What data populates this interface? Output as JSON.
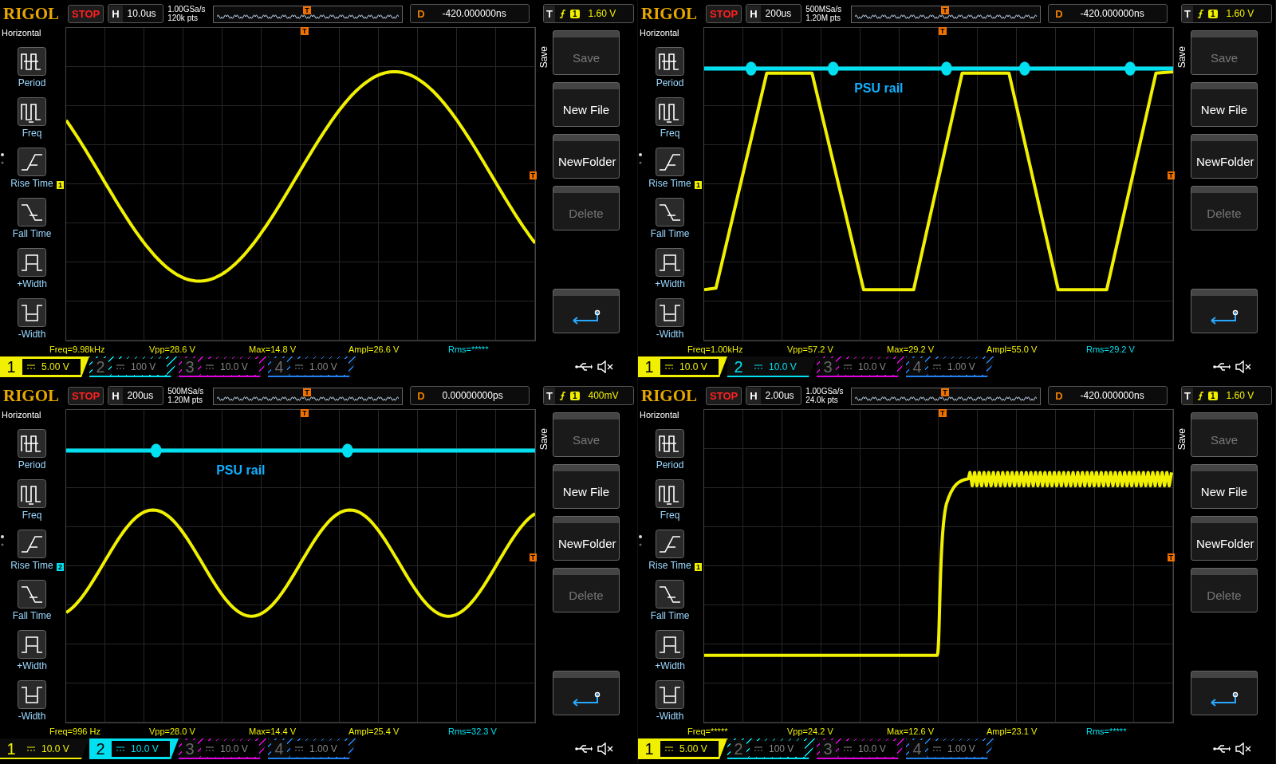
{
  "panels": [
    {
      "brand": "RIGOL",
      "status": "STOP",
      "timebase": {
        "label": "H",
        "value": "10.0us"
      },
      "sample_rate": "1.00GSa/s",
      "memory_depth": "120k pts",
      "memory_marker": "T",
      "delay": {
        "label": "D",
        "value": "-420.000000ns"
      },
      "trigger": {
        "label": "T",
        "source": "1",
        "level": "1.60 V"
      },
      "sidebar": {
        "title": "Horizontal",
        "items": [
          "Period",
          "Freq",
          "Rise Time",
          "Fall Time",
          "+Width",
          "-Width"
        ]
      },
      "graticule": {
        "trigger_marker": "T",
        "channel_marker": {
          "label": "1",
          "color": "#f0f000"
        },
        "level_marker": "T",
        "traces": [
          {
            "kind": "sine-slow",
            "color": "#f0f000"
          }
        ]
      },
      "menu": {
        "title": "Save",
        "buttons": [
          {
            "kind": "text",
            "label": "Save",
            "disabled": true
          },
          {
            "kind": "text",
            "label": "New File",
            "disabled": false
          },
          {
            "kind": "text",
            "label": "NewFolder",
            "disabled": false
          },
          {
            "kind": "text",
            "label": "Delete",
            "disabled": true
          },
          {
            "kind": "return"
          }
        ]
      },
      "measurements": [
        {
          "text": "Freq=9.98kHz",
          "color": "#f0f000"
        },
        {
          "text": "Vpp=28.6 V",
          "color": "#f0f000"
        },
        {
          "text": "Max=14.8 V",
          "color": "#f0f000"
        },
        {
          "text": "Ampl=26.6 V",
          "color": "#f0f000"
        },
        {
          "text": "Rms=*****",
          "color": "#00e0f0"
        }
      ],
      "channels": [
        {
          "label": "1",
          "scale": "5.00 V",
          "color": "#f0f000",
          "on": true,
          "selected": true
        },
        {
          "label": "2",
          "scale": "100 V",
          "color": "#00e0f0",
          "on": false,
          "selected": false
        },
        {
          "label": "3",
          "scale": "10.0 V",
          "color": "#e000e0",
          "on": false,
          "selected": false
        },
        {
          "label": "4",
          "scale": "1.00 V",
          "color": "#2080f0",
          "on": false,
          "selected": false
        }
      ]
    },
    {
      "brand": "RIGOL",
      "status": "STOP",
      "timebase": {
        "label": "H",
        "value": "200us"
      },
      "sample_rate": "500MSa/s",
      "memory_depth": "1.20M pts",
      "memory_marker": "T",
      "delay": {
        "label": "D",
        "value": "-420.000000ns"
      },
      "trigger": {
        "label": "T",
        "source": "1",
        "level": "1.60 V"
      },
      "sidebar": {
        "title": "Horizontal",
        "items": [
          "Period",
          "Freq",
          "Rise Time",
          "Fall Time",
          "+Width",
          "-Width"
        ]
      },
      "graticule": {
        "trigger_marker": "T",
        "channel_marker": {
          "label": "1",
          "color": "#f0f000"
        },
        "level_marker": "T",
        "annotation": "PSU rail",
        "traces": [
          {
            "kind": "trapezoid",
            "color": "#f0f000"
          },
          {
            "kind": "rail",
            "color": "#00e0f0"
          }
        ]
      },
      "menu": {
        "title": "Save",
        "buttons": [
          {
            "kind": "text",
            "label": "Save",
            "disabled": true
          },
          {
            "kind": "text",
            "label": "New File",
            "disabled": false
          },
          {
            "kind": "text",
            "label": "NewFolder",
            "disabled": false
          },
          {
            "kind": "text",
            "label": "Delete",
            "disabled": true
          },
          {
            "kind": "return"
          }
        ]
      },
      "measurements": [
        {
          "text": "Freq=1.00kHz",
          "color": "#f0f000"
        },
        {
          "text": "Vpp=57.2 V",
          "color": "#f0f000"
        },
        {
          "text": "Max=29.2 V",
          "color": "#f0f000"
        },
        {
          "text": "Ampl=55.0 V",
          "color": "#f0f000"
        },
        {
          "text": "Rms=29.2 V",
          "color": "#00e0f0"
        }
      ],
      "channels": [
        {
          "label": "1",
          "scale": "10.0 V",
          "color": "#f0f000",
          "on": true,
          "selected": true
        },
        {
          "label": "2",
          "scale": "10.0 V",
          "color": "#00e0f0",
          "on": true,
          "selected": false
        },
        {
          "label": "3",
          "scale": "10.0 V",
          "color": "#e000e0",
          "on": false,
          "selected": false
        },
        {
          "label": "4",
          "scale": "1.00 V",
          "color": "#2080f0",
          "on": false,
          "selected": false
        }
      ]
    },
    {
      "brand": "RIGOL",
      "status": "STOP",
      "timebase": {
        "label": "H",
        "value": "200us"
      },
      "sample_rate": "500MSa/s",
      "memory_depth": "1.20M pts",
      "memory_marker": "T",
      "delay": {
        "label": "D",
        "value": "0.00000000ps"
      },
      "trigger": {
        "label": "T",
        "source": "1",
        "level": "400mV"
      },
      "sidebar": {
        "title": "Horizontal",
        "items": [
          "Period",
          "Freq",
          "Rise Time",
          "Fall Time",
          "+Width",
          "-Width"
        ]
      },
      "graticule": {
        "trigger_marker": "T",
        "channel_marker": {
          "label": "2",
          "color": "#00e0f0"
        },
        "level_marker": "T",
        "annotation": "PSU rail",
        "traces": [
          {
            "kind": "sine-fast",
            "color": "#f0f000"
          },
          {
            "kind": "rail",
            "color": "#00e0f0"
          }
        ]
      },
      "menu": {
        "title": "Save",
        "buttons": [
          {
            "kind": "text",
            "label": "Save",
            "disabled": true
          },
          {
            "kind": "text",
            "label": "New File",
            "disabled": false
          },
          {
            "kind": "text",
            "label": "NewFolder",
            "disabled": false
          },
          {
            "kind": "text",
            "label": "Delete",
            "disabled": true
          },
          {
            "kind": "return"
          }
        ]
      },
      "measurements": [
        {
          "text": "Freq=996 Hz",
          "color": "#f0f000"
        },
        {
          "text": "Vpp=28.0 V",
          "color": "#f0f000"
        },
        {
          "text": "Max=14.4 V",
          "color": "#f0f000"
        },
        {
          "text": "Ampl=25.4 V",
          "color": "#f0f000"
        },
        {
          "text": "Rms=32.3 V",
          "color": "#00e0f0"
        }
      ],
      "channels": [
        {
          "label": "1",
          "scale": "10.0 V",
          "color": "#f0f000",
          "on": true,
          "selected": false
        },
        {
          "label": "2",
          "scale": "10.0 V",
          "color": "#00e0f0",
          "on": true,
          "selected": true
        },
        {
          "label": "3",
          "scale": "10.0 V",
          "color": "#e000e0",
          "on": false,
          "selected": false
        },
        {
          "label": "4",
          "scale": "1.00 V",
          "color": "#2080f0",
          "on": false,
          "selected": false
        }
      ]
    },
    {
      "brand": "RIGOL",
      "status": "STOP",
      "timebase": {
        "label": "H",
        "value": "2.00us"
      },
      "sample_rate": "1.00GSa/s",
      "memory_depth": "24.0k pts",
      "memory_marker": "T",
      "delay": {
        "label": "D",
        "value": "-420.000000ns"
      },
      "trigger": {
        "label": "T",
        "source": "1",
        "level": "1.60 V"
      },
      "sidebar": {
        "title": "Horizontal",
        "items": [
          "Period",
          "Freq",
          "Rise Time",
          "Fall Time",
          "+Width",
          "-Width"
        ]
      },
      "graticule": {
        "trigger_marker": "T",
        "channel_marker": {
          "label": "1",
          "color": "#f0f000"
        },
        "level_marker": "T",
        "traces": [
          {
            "kind": "step",
            "color": "#f0f000"
          }
        ]
      },
      "menu": {
        "title": "Save",
        "buttons": [
          {
            "kind": "text",
            "label": "Save",
            "disabled": true
          },
          {
            "kind": "text",
            "label": "New File",
            "disabled": false
          },
          {
            "kind": "text",
            "label": "NewFolder",
            "disabled": false
          },
          {
            "kind": "text",
            "label": "Delete",
            "disabled": true
          },
          {
            "kind": "return"
          }
        ]
      },
      "measurements": [
        {
          "text": "Freq=*****",
          "color": "#f0f000"
        },
        {
          "text": "Vpp=24.2 V",
          "color": "#f0f000"
        },
        {
          "text": "Max=12.6 V",
          "color": "#f0f000"
        },
        {
          "text": "Ampl=23.1 V",
          "color": "#f0f000"
        },
        {
          "text": "Rms=*****",
          "color": "#00e0f0"
        }
      ],
      "channels": [
        {
          "label": "1",
          "scale": "5.00 V",
          "color": "#f0f000",
          "on": true,
          "selected": true
        },
        {
          "label": "2",
          "scale": "100 V",
          "color": "#00e0f0",
          "on": false,
          "selected": false
        },
        {
          "label": "3",
          "scale": "10.0 V",
          "color": "#e000e0",
          "on": false,
          "selected": false
        },
        {
          "label": "4",
          "scale": "1.00 V",
          "color": "#2080f0",
          "on": false,
          "selected": false
        }
      ]
    }
  ]
}
